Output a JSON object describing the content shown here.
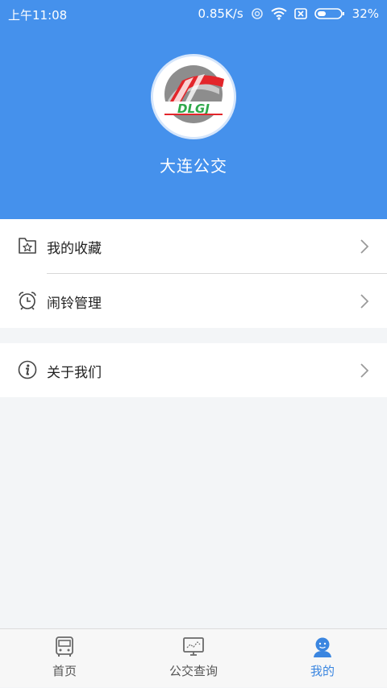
{
  "status_bar": {
    "time": "上午11:08",
    "net_speed": "0.85K/s",
    "battery": "32%"
  },
  "header": {
    "logo_text": "DLGJ",
    "app_name": "大连公交"
  },
  "menu": {
    "group1": [
      {
        "label": "我的收藏",
        "icon": "star-folder-icon"
      },
      {
        "label": "闹铃管理",
        "icon": "alarm-clock-icon"
      }
    ],
    "group2": [
      {
        "label": "关于我们",
        "icon": "info-icon"
      }
    ]
  },
  "tabs": [
    {
      "label": "首页",
      "icon": "bus-icon",
      "active": false
    },
    {
      "label": "公交查询",
      "icon": "monitor-icon",
      "active": false
    },
    {
      "label": "我的",
      "icon": "user-icon",
      "active": true
    }
  ],
  "colors": {
    "header_blue": "#4591ec",
    "accent": "#3b86e0",
    "logo_red": "#e3262b",
    "logo_green": "#2fa84a"
  }
}
